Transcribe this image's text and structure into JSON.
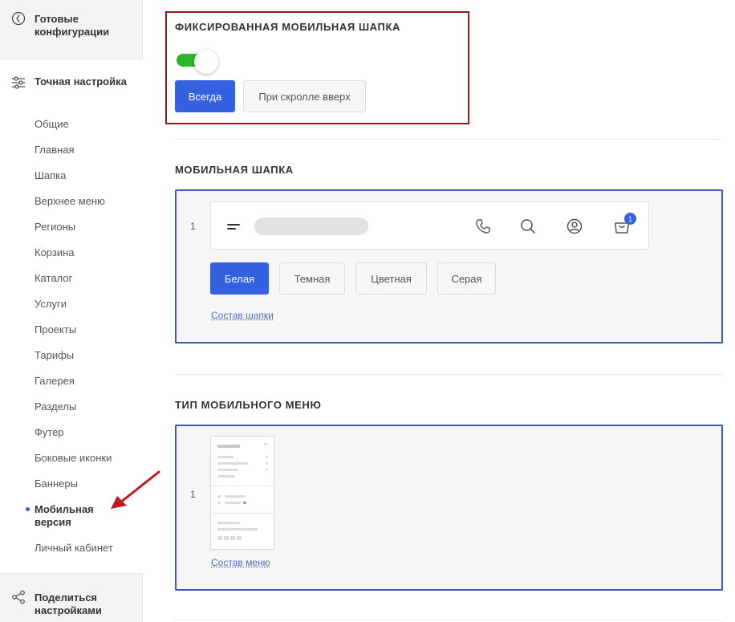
{
  "sidebar": {
    "ready_configs": "Готовые конфигурации",
    "fine_tuning": "Точная настройка",
    "items": [
      "Общие",
      "Главная",
      "Шапка",
      "Верхнее меню",
      "Регионы",
      "Корзина",
      "Каталог",
      "Услуги",
      "Проекты",
      "Тарифы",
      "Галерея",
      "Разделы",
      "Футер",
      "Боковые иконки",
      "Баннеры",
      "Мобильная версия",
      "Личный кабинет"
    ],
    "active_item": "Мобильная версия",
    "share": "Поделиться настройками"
  },
  "fixed_header": {
    "title": "ФИКСИРОВАННАЯ МОБИЛЬНАЯ ШАПКА",
    "toggle_on": true,
    "options": [
      "Всегда",
      "При скролле вверх"
    ],
    "selected": "Всегда"
  },
  "mobile_header": {
    "title": "МОБИЛЬНАЯ ШАПКА",
    "number": "1",
    "cart_badge": "1",
    "color_options": [
      "Белая",
      "Темная",
      "Цветная",
      "Серая"
    ],
    "selected": "Белая",
    "link": "Состав шапки"
  },
  "mobile_menu": {
    "title": "ТИП МОБИЛЬНОГО МЕНЮ",
    "number": "1",
    "link": "Состав меню"
  },
  "colors": {
    "accent": "#3461e0",
    "toggle_green": "#2db52d",
    "highlight_border": "#8b1a1a",
    "arrow": "#c0181e"
  }
}
